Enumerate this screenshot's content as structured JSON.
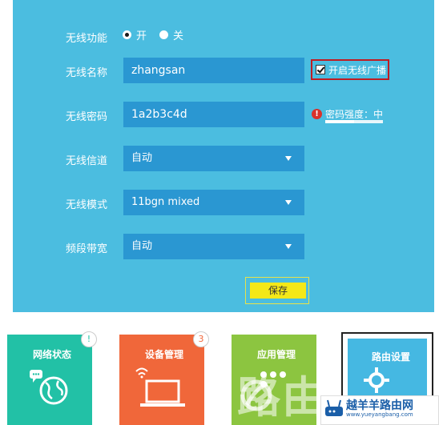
{
  "wireless": {
    "function_label": "无线功能",
    "on_label": "开",
    "off_label": "关",
    "selected": "开",
    "name_label": "无线名称",
    "ssid_value": "zhangsan",
    "broadcast_label": "开启无线广播",
    "broadcast_checked": true,
    "password_label": "无线密码",
    "password_value": "1a2b3c4d",
    "strength_label": "密码强度：中",
    "strength_level": 0.5,
    "channel_label": "无线信道",
    "channel_value": "自动",
    "mode_label": "无线模式",
    "mode_value": "11bgn mixed",
    "bandwidth_label": "频段带宽",
    "bandwidth_value": "自动",
    "save_label": "保存"
  },
  "tiles": [
    {
      "label": "网络状态",
      "color": "#22c1a6",
      "badge": "!",
      "badge_color": "#22c1a6",
      "icon": "globe-icon"
    },
    {
      "label": "设备管理",
      "color": "#f0673a",
      "badge": "3",
      "badge_color": "#f0673a",
      "icon": "laptop-icon"
    },
    {
      "label": "应用管理",
      "color": "#8cc540",
      "icon": "apps-icon"
    },
    {
      "label": "路由设置",
      "color": "#45b8e2",
      "icon": "gear-icon",
      "selected": true
    }
  ],
  "watermark": {
    "text": "路由"
  },
  "logo": {
    "title": "越羊羊路由网",
    "url": "www.yueyangbang.com"
  },
  "colors": {
    "panel": "#4bbde0",
    "field": "#2a97d2",
    "save": "#f4e818"
  }
}
